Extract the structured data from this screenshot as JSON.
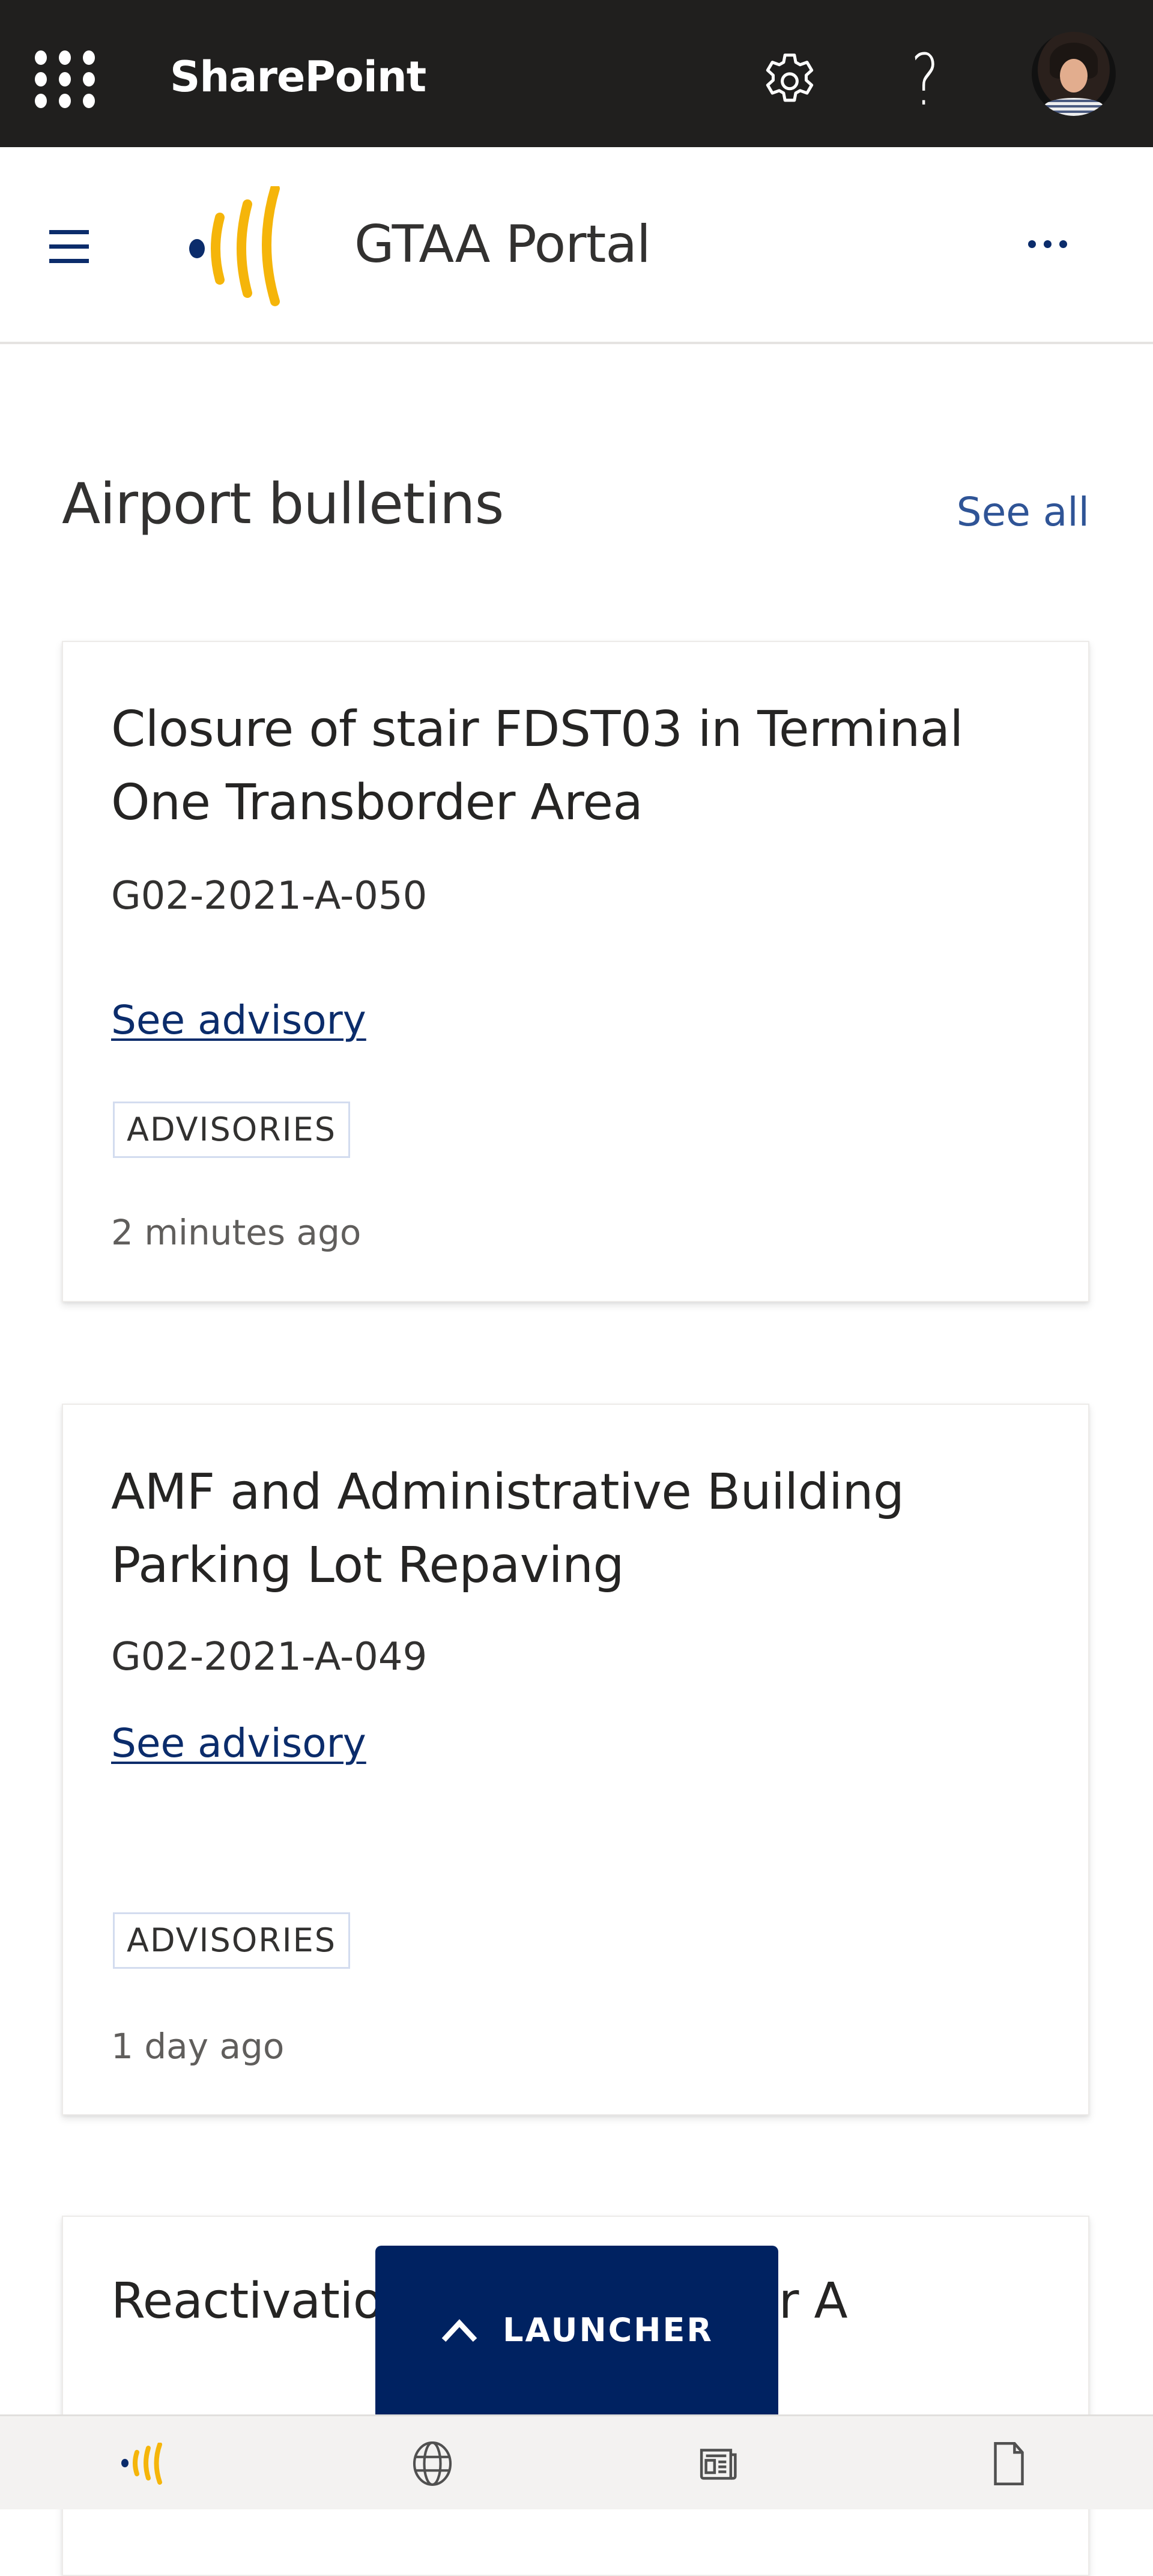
{
  "suite_bar": {
    "app_name": "SharePoint",
    "icons": {
      "app_launcher": "waffle-icon",
      "settings": "gear-icon",
      "help": "help-icon",
      "profile": "avatar"
    },
    "help_glyph": "?",
    "background_color": "#201f1e"
  },
  "site_header": {
    "title": "GTAA Portal",
    "icons": {
      "nav": "hamburger-icon",
      "logo": "gtaa-logo",
      "more": "more-ellipsis-icon"
    },
    "brand_colors": {
      "navy": "#0b2c6b",
      "gold": "#f5b50a"
    }
  },
  "bulletins": {
    "title": "Airport bulletins",
    "see_all_label": "See all",
    "items": [
      {
        "title": "Closure of stair FDST03 in Terminal One Transborder Area",
        "code": "G02-2021-A-050",
        "link_label": "See advisory",
        "tag": "ADVISORIES",
        "time": "2 minutes ago"
      },
      {
        "title": "AMF and Administrative Building Parking Lot Repaving",
        "code": "G02-2021-A-049",
        "link_label": "See advisory",
        "tag": "ADVISORIES",
        "time": "1 day ago"
      },
      {
        "title": "Reactivation … Pier A",
        "title_visible_left": "Reactivatio",
        "title_visible_right": "Pier A"
      }
    ]
  },
  "launcher": {
    "label": "LAUNCHER",
    "icon": "chevron-up-icon",
    "color": "#002261"
  },
  "bottom_nav": {
    "items": [
      {
        "name": "home",
        "icon": "gtaa-logo-icon"
      },
      {
        "name": "sites",
        "icon": "globe-icon"
      },
      {
        "name": "news",
        "icon": "news-icon"
      },
      {
        "name": "files",
        "icon": "document-icon"
      }
    ]
  }
}
